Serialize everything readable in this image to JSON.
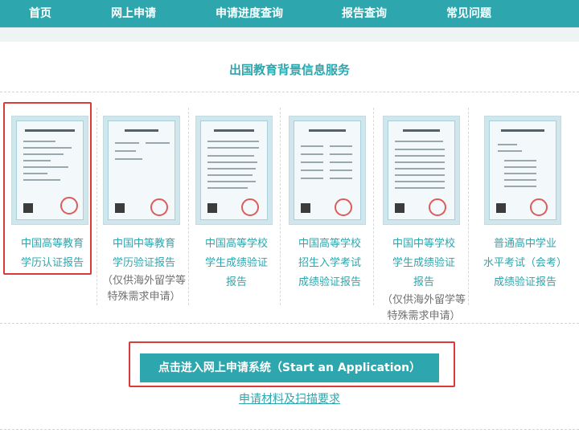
{
  "nav": {
    "items": [
      {
        "label": "首页"
      },
      {
        "label": "网上申请"
      },
      {
        "label": "申请进度查询"
      },
      {
        "label": "报告查询"
      },
      {
        "label": "常见问题"
      }
    ],
    "background_color": "#2ea6ad"
  },
  "service": {
    "title": "出国教育背景信息服务"
  },
  "cards": [
    {
      "title_line1": "中国高等教育",
      "title_line2": "学历认证报告",
      "note_line1": "",
      "note_line2": ""
    },
    {
      "title_line1": "中国中等教育",
      "title_line2": "学历验证报告",
      "note_line1": "（仅供海外留学等",
      "note_line2": "特殊需求申请）"
    },
    {
      "title_line1": "中国高等学校",
      "title_line2": "学生成绩验证",
      "title_line3": "报告",
      "note_line1": "",
      "note_line2": ""
    },
    {
      "title_line1": "中国高等学校",
      "title_line2": "招生入学考试",
      "title_line3": "成绩验证报告",
      "note_line1": "",
      "note_line2": ""
    },
    {
      "title_line1": "中国中等学校",
      "title_line2": "学生成绩验证",
      "title_line3": "报告",
      "note_line1": "（仅供海外留学等",
      "note_line2": "特殊需求申请）"
    },
    {
      "title_line1": "普通高中学业",
      "title_line2": "水平考试（会考）",
      "title_line3": "成绩验证报告",
      "note_line1": "",
      "note_line2": ""
    }
  ],
  "actions": {
    "apply_label": "点击进入网上申请系统（Start an Application）",
    "materials_link": "申请材料及扫描要求"
  },
  "colors": {
    "accent": "#2ea6ad",
    "highlight": "#d93a3a",
    "note_text": "#707070"
  }
}
